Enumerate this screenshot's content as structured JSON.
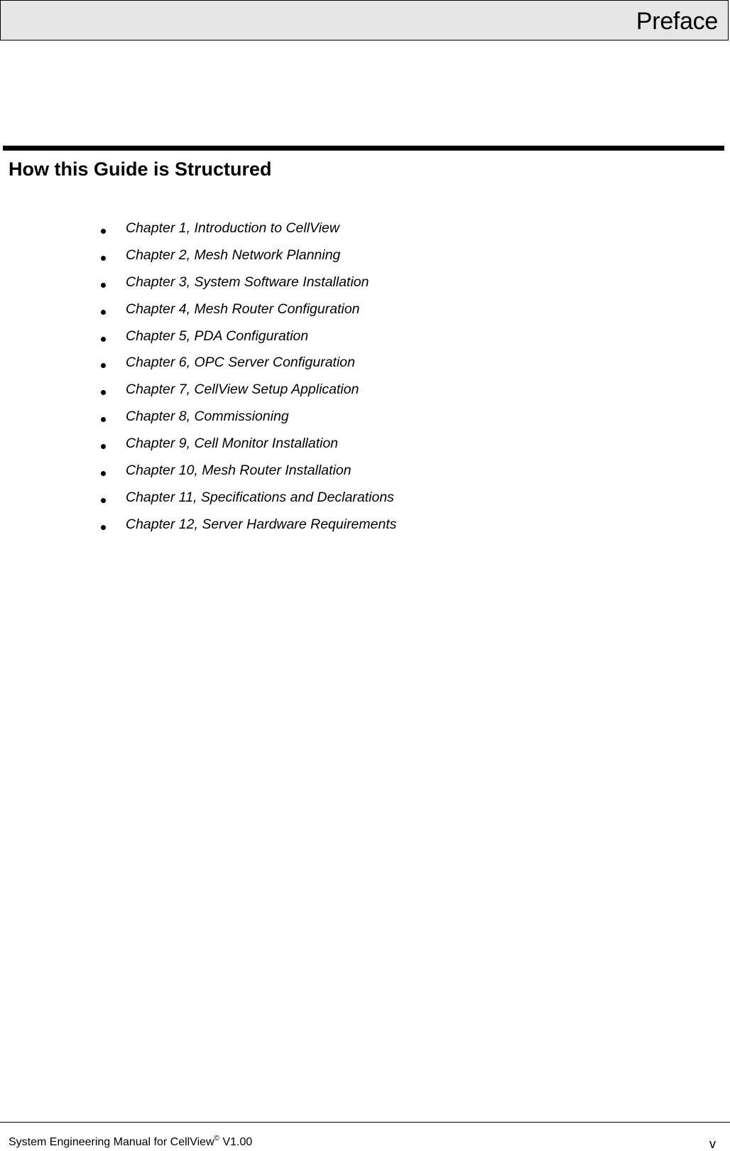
{
  "header": {
    "title": "Preface"
  },
  "section": {
    "title": "How this Guide is Structured"
  },
  "chapters": [
    "Chapter 1, Introduction to CellView",
    "Chapter 2, Mesh Network Planning",
    "Chapter 3, System Software Installation",
    "Chapter 4, Mesh Router Configuration",
    "Chapter 5, PDA Configuration",
    "Chapter 6, OPC Server Configuration",
    "Chapter 7, CellView Setup Application",
    "Chapter 8, Commissioning",
    "Chapter 9, Cell Monitor Installation",
    "Chapter 10, Mesh Router Installation",
    "Chapter 11, Specifications and Declarations",
    "Chapter 12, Server Hardware Requirements"
  ],
  "footer": {
    "manual_title": "System Engineering Manual for CellView",
    "copyright_symbol": "©",
    "version": " V1.00",
    "page_number": "v"
  },
  "colors": {
    "header_background": "#e6e6e6",
    "text": "#000000"
  }
}
